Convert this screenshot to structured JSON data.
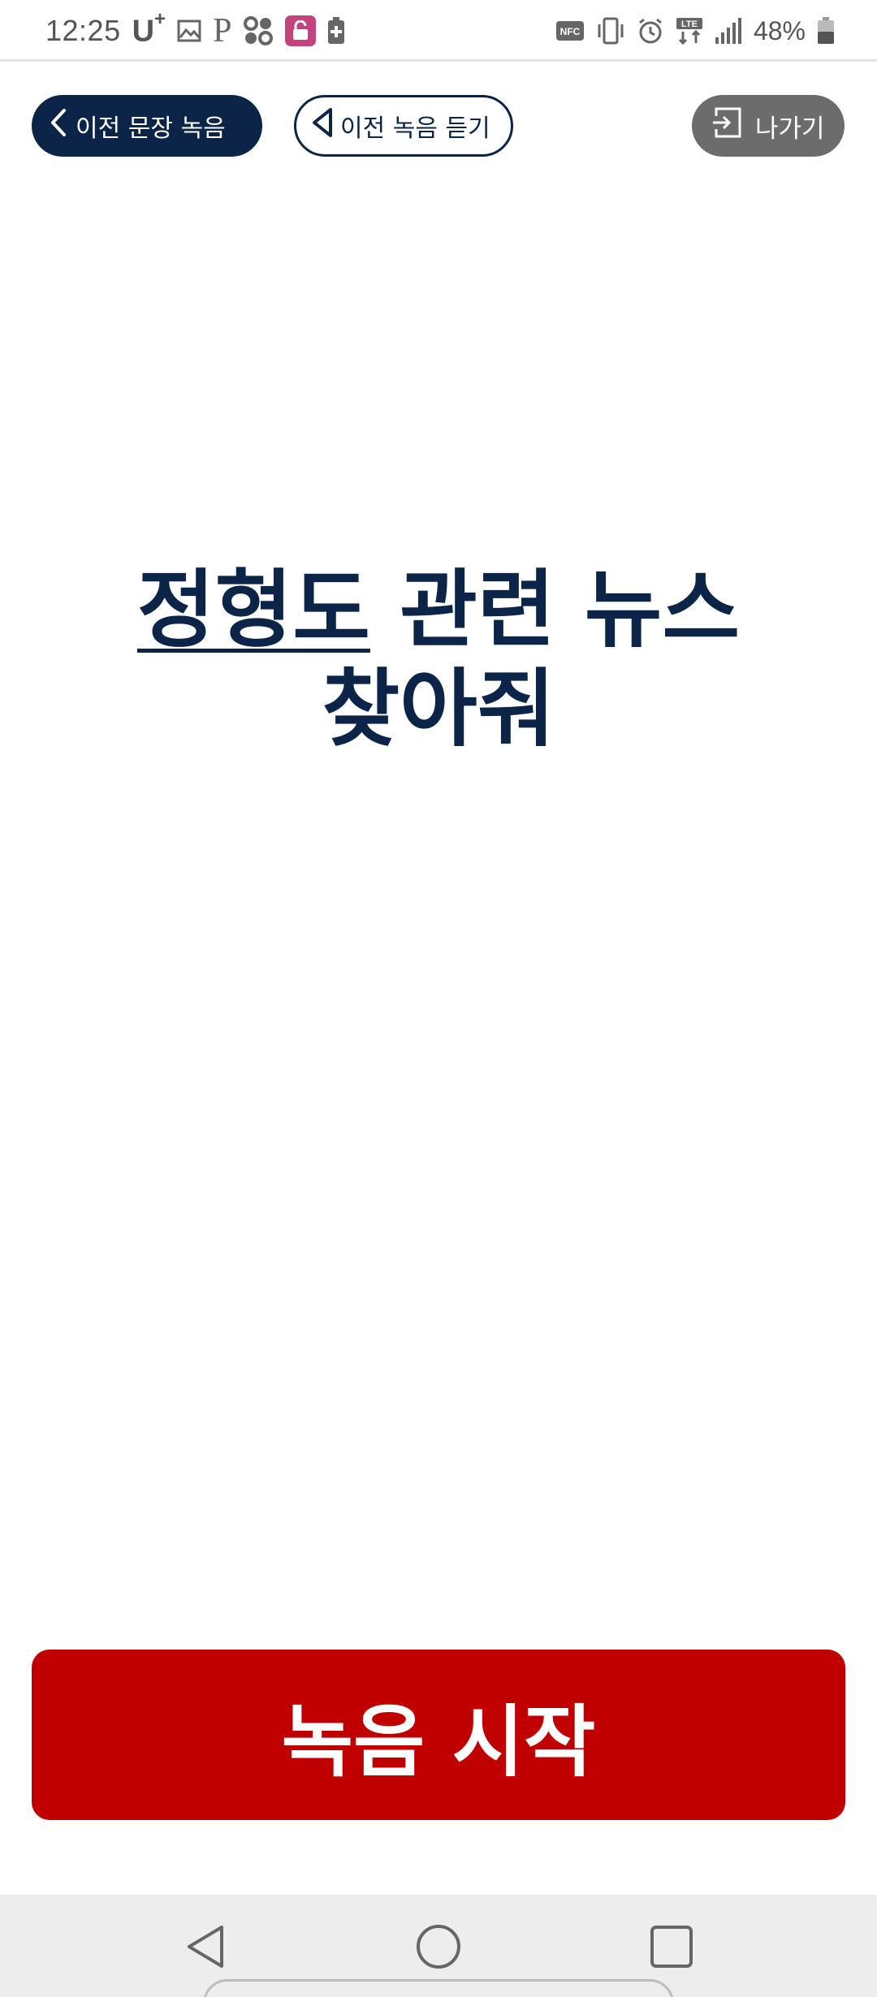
{
  "status_bar": {
    "time": "12:25",
    "carrier": "U",
    "carrier_sup": "+",
    "battery": "48%",
    "icons": [
      "image-icon",
      "p-icon",
      "grid-icon",
      "lock-icon",
      "battery-plus-icon",
      "nfc-icon",
      "vibrate-icon",
      "alarm-icon",
      "lte-icon",
      "signal-icon",
      "battery-icon"
    ]
  },
  "toolbar": {
    "prev_sentence_label": "이전 문장 녹음",
    "prev_listen_label": "이전 녹음 듣기",
    "exit_label": "나가기"
  },
  "sentence": {
    "highlighted": "정형도",
    "rest_line1": " 관련 뉴스",
    "line2": "찾아줘"
  },
  "record_button": {
    "label": "녹음 시작"
  },
  "colors": {
    "navy": "#0b2447",
    "record_red": "#c00000",
    "exit_gray": "#6c6c6c"
  }
}
